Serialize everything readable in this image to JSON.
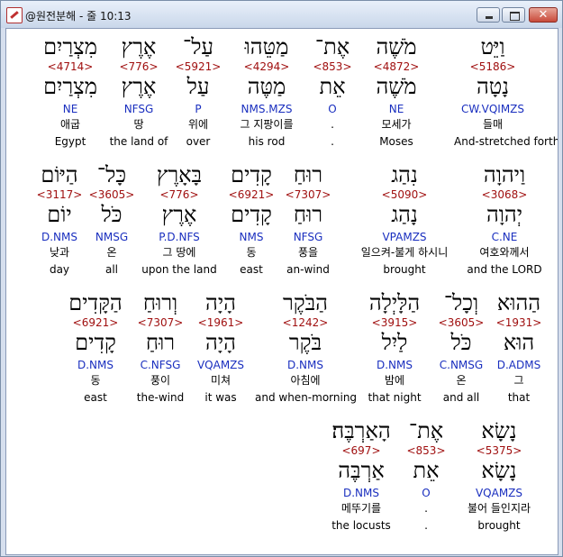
{
  "window": {
    "title": "@원전분해 - 줄 10:13",
    "minimize_glyph": "",
    "maximize_glyph": "",
    "close_glyph": "✕"
  },
  "rows": [
    [
      {
        "heb": "וַיֵּט",
        "strong": "<5186>",
        "heb2": "נָטָה",
        "parse": "CW.VQIMZS",
        "kor": "들매",
        "eng": "And-stretched forth"
      },
      {
        "heb": "מֹשֶׁה",
        "strong": "<4872>",
        "heb2": "מֹשֶׁה",
        "parse": "NE",
        "kor": "모세가",
        "eng": "Moses"
      },
      {
        "heb": "אֶת־",
        "strong": "<853>",
        "heb2": "אֵת",
        "parse": "O",
        "kor": ".",
        "eng": "."
      },
      {
        "heb": "מַטֵּהוּ",
        "strong": "<4294>",
        "heb2": "מַטֶּה",
        "parse": "NMS.MZS",
        "kor": "그 지팡이를",
        "eng": "his rod"
      },
      {
        "heb": "עַל־",
        "strong": "<5921>",
        "heb2": "עַל",
        "parse": "P",
        "kor": "위에",
        "eng": "over"
      },
      {
        "heb": "אֶרֶץ",
        "strong": "<776>",
        "heb2": "אֶרֶץ",
        "parse": "NFSG",
        "kor": "땅",
        "eng": "the land of"
      },
      {
        "heb": "מִצְרַיִם",
        "strong": "<4714>",
        "heb2": "מִצְרַיִם",
        "parse": "NE",
        "kor": "애굽",
        "eng": "Egypt"
      }
    ],
    [
      {
        "heb": "וַיהוָה",
        "strong": "<3068>",
        "heb2": "יְהוָה",
        "parse": "C.NE",
        "kor": "여호와께서",
        "eng": "and the LORD"
      },
      {
        "heb": "נִהַג",
        "strong": "<5090>",
        "heb2": "נָהַג",
        "parse": "VPAMZS",
        "kor": "일으켜-불게 하시니",
        "eng": "brought"
      },
      {
        "heb": "רוּחַ",
        "strong": "<7307>",
        "heb2": "רוּחַ",
        "parse": "NFSG",
        "kor": "풍을",
        "eng": "an-wind"
      },
      {
        "heb": "קָדִים",
        "strong": "<6921>",
        "heb2": "קָדִים",
        "parse": "NMS",
        "kor": "동",
        "eng": "east"
      },
      {
        "heb": "בָּאָרֶץ",
        "strong": "<776>",
        "heb2": "אֶרֶץ",
        "parse": "P.D.NFS",
        "kor": "그 땅에",
        "eng": "upon the land"
      },
      {
        "heb": "כָּל־",
        "strong": "<3605>",
        "heb2": "כֹּל",
        "parse": "NMSG",
        "kor": "온",
        "eng": "all"
      },
      {
        "heb": "הַיּוֹם",
        "strong": "<3117>",
        "heb2": "יוֹם",
        "parse": "D.NMS",
        "kor": "낮과",
        "eng": "day"
      }
    ],
    [
      {
        "heb": "הַהוּא",
        "strong": "<1931>",
        "heb2": "הוּא",
        "parse": "D.ADMS",
        "kor": "그",
        "eng": "that"
      },
      {
        "heb": "וְכָל־",
        "strong": "<3605>",
        "heb2": "כֹּל",
        "parse": "C.NMSG",
        "kor": "온",
        "eng": "and all"
      },
      {
        "heb": "הַלָּיְלָה",
        "strong": "<3915>",
        "heb2": "לַיִל",
        "parse": "D.NMS",
        "kor": "밤에",
        "eng": "that night"
      },
      {
        "heb": "הַבֹּקֶר",
        "strong": "<1242>",
        "heb2": "בֹּקֶר",
        "parse": "D.NMS",
        "kor": "아침에",
        "eng": "and when-morning"
      },
      {
        "heb": "הָיָה",
        "strong": "<1961>",
        "heb2": "הָיָה",
        "parse": "VQAMZS",
        "kor": "미쳐",
        "eng": "it was"
      },
      {
        "heb": "וְרוּחַ",
        "strong": "<7307>",
        "heb2": "רוּחַ",
        "parse": "C.NFSG",
        "kor": "풍이",
        "eng": "the-wind"
      },
      {
        "heb": "הַקָּדִים",
        "strong": "<6921>",
        "heb2": "קָדִים",
        "parse": "D.NMS",
        "kor": "동",
        "eng": "east"
      }
    ],
    [
      {
        "heb": "נָשָׂא",
        "strong": "<5375>",
        "heb2": "נָשָׂא",
        "parse": "VQAMZS",
        "kor": "불어 들인지라",
        "eng": "brought"
      },
      {
        "heb": "אֶת־",
        "strong": "<853>",
        "heb2": "אֵת",
        "parse": "O",
        "kor": ".",
        "eng": "."
      },
      {
        "heb": "הָאַרְבֶּה׃",
        "strong": "<697>",
        "heb2": "אַרְבֶּה",
        "parse": "D.NMS",
        "kor": "메뚜기를",
        "eng": "the locusts"
      }
    ]
  ]
}
